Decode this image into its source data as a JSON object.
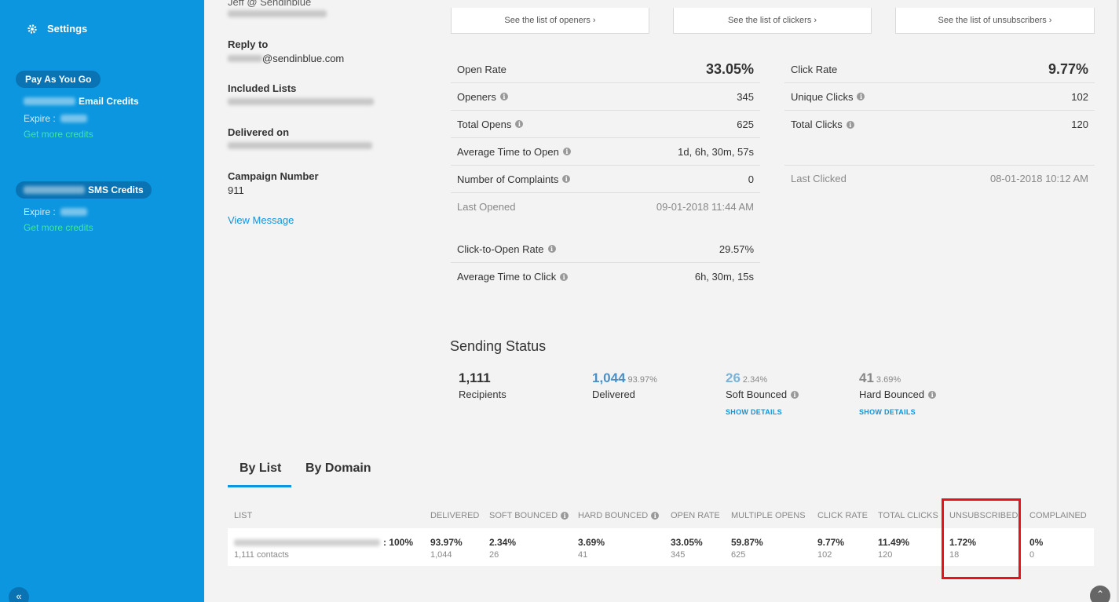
{
  "sidebar": {
    "settings_label": "Settings",
    "plan_label": "Pay As You Go",
    "email_credits_label": "Email Credits",
    "expire_label": "Expire :",
    "get_more_credits_email": "Get more credits",
    "sms_credits_label": "SMS Credits",
    "get_more_credits_sms": "Get more credits",
    "collapse_icon": "«",
    "colors": {
      "background": "#0b96df",
      "pill": "#0a73b3",
      "link": "#42e6a2"
    }
  },
  "details": {
    "sender_name": "Jeff @ Sendinblue",
    "reply_to_label": "Reply to",
    "reply_to_domain": "@sendinblue.com",
    "included_lists_label": "Included Lists",
    "delivered_on_label": "Delivered on",
    "campaign_number_label": "Campaign Number",
    "campaign_number": "911",
    "view_message": "View Message"
  },
  "top_buttons": {
    "openers": "See the list of openers ›",
    "clickers": "See the list of clickers ›",
    "unsubscribers": "See the list of unsubscribers ›"
  },
  "open_stats": {
    "title": "Open Rate",
    "value": "33.05%",
    "rows": [
      {
        "label": "Openers",
        "value": "345"
      },
      {
        "label": "Total Opens",
        "value": "625"
      },
      {
        "label": "Average Time to Open",
        "value": "1d, 6h, 30m, 57s"
      },
      {
        "label": "Number of Complaints",
        "value": "0"
      }
    ],
    "last_opened_label": "Last Opened",
    "last_opened_value": "09-01-2018 11:44 AM",
    "cto_label": "Click-to-Open Rate",
    "cto_value": "29.57%",
    "atc_label": "Average Time to Click",
    "atc_value": "6h, 30m, 15s"
  },
  "click_stats": {
    "title": "Click Rate",
    "value": "9.77%",
    "rows": [
      {
        "label": "Unique Clicks",
        "value": "102"
      },
      {
        "label": "Total Clicks",
        "value": "120"
      }
    ],
    "last_clicked_label": "Last Clicked",
    "last_clicked_value": "08-01-2018 10:12 AM"
  },
  "sending_status": {
    "title": "Sending Status",
    "recipients": {
      "num": "1,111",
      "label": "Recipients"
    },
    "delivered": {
      "num": "1,044",
      "pct": "93.97%",
      "label": "Delivered"
    },
    "soft_bounced": {
      "num": "26",
      "pct": "2.34%",
      "label": "Soft Bounced",
      "details": "SHOW DETAILS"
    },
    "hard_bounced": {
      "num": "41",
      "pct": "3.69%",
      "label": "Hard Bounced",
      "details": "SHOW DETAILS"
    }
  },
  "tabs": {
    "by_list": "By List",
    "by_domain": "By Domain"
  },
  "table": {
    "headers": [
      "LIST",
      "DELIVERED",
      "SOFT BOUNCED",
      "HARD BOUNCED",
      "OPEN RATE",
      "MULTIPLE OPENS",
      "CLICK RATE",
      "TOTAL CLICKS",
      "UNSUBSCRIBED",
      "COMPLAINED"
    ],
    "row": {
      "list_pct": ": 100%",
      "list_contacts": "1,111 contacts",
      "cells": [
        {
          "main": "93.97%",
          "sub": "1,044"
        },
        {
          "main": "2.34%",
          "sub": "26"
        },
        {
          "main": "3.69%",
          "sub": "41"
        },
        {
          "main": "33.05%",
          "sub": "345"
        },
        {
          "main": "59.87%",
          "sub": "625"
        },
        {
          "main": "9.77%",
          "sub": "102"
        },
        {
          "main": "11.49%",
          "sub": "120"
        },
        {
          "main": "1.72%",
          "sub": "18"
        },
        {
          "main": "0%",
          "sub": "0"
        }
      ]
    },
    "highlight_color": "#e5141b"
  },
  "scroll_top_icon": "⌃"
}
